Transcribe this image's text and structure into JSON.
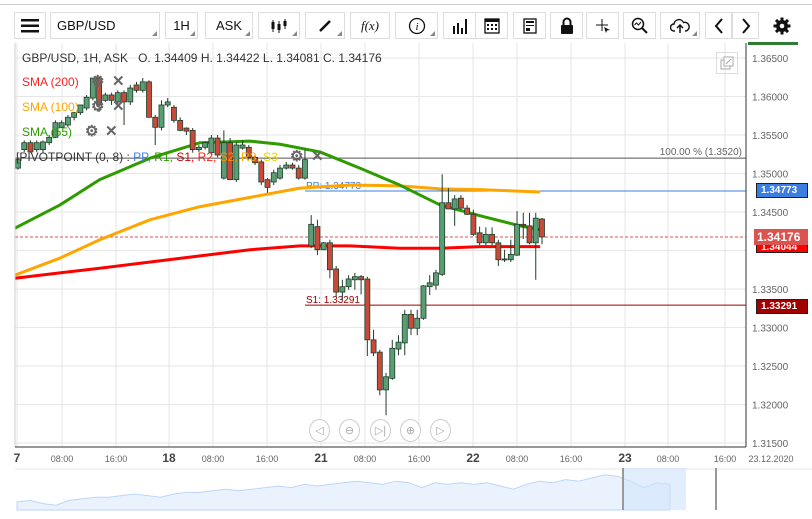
{
  "toolbar": {
    "menu_icon": "hamburger-icon",
    "symbol": "GBP/USD",
    "timeframe": "1H",
    "price_side": "ASK",
    "buttons": [
      "candle-type-icon",
      "pen-icon",
      "function-icon",
      "info-icon",
      "bar-chart-icon",
      "calendar-icon",
      "report-icon",
      "lock-icon",
      "crosshair-icon",
      "zoom-icon",
      "cloud-upload-icon",
      "chevron-left-icon",
      "chevron-right-icon",
      "gear-icon"
    ],
    "function_label": "f(x)"
  },
  "header": {
    "instrument": "GBP/USD, 1H, ASK",
    "o_label": "O.",
    "o": "1.34409",
    "h_label": "H.",
    "h": "1.34422",
    "l_label": "L.",
    "l": "1.34081",
    "c_label": "C.",
    "c": "1.34176"
  },
  "indicators": [
    {
      "label": "SMA (200)",
      "color": "#ff0000"
    },
    {
      "label": "SMA (100)",
      "color": "#ffa500"
    },
    {
      "label": "SMA (55)",
      "color": "#2e9b00"
    }
  ],
  "pivot": {
    "label": "PIVOTPOINT (0, 8)",
    "sep": " : ",
    "items": [
      {
        "t": "PP,",
        "c": "#3b82f6"
      },
      {
        "t": "R1,",
        "c": "#2e9b00"
      },
      {
        "t": "S1,",
        "c": "#cc0000"
      },
      {
        "t": "R2,",
        "c": "#ff2020"
      },
      {
        "t": "S2,",
        "c": "#ff8c00"
      },
      {
        "t": "R3,",
        "c": "#ffa500"
      },
      {
        "t": "S3",
        "c": "#e8d800"
      }
    ]
  },
  "chart_data": {
    "type": "candlestick",
    "ylim": [
      1.315,
      1.3665
    ],
    "y_ticks": [
      "1.36500",
      "1.36000",
      "1.35500",
      "1.35000",
      "1.34500",
      "1.33500",
      "1.33000",
      "1.32500",
      "1.32000",
      "1.31500"
    ],
    "x_ticks": [
      "7",
      "08:00",
      "16:00",
      "18",
      "08:00",
      "16:00",
      "21",
      "08:00",
      "16:00",
      "22",
      "08:00",
      "16:00",
      "23",
      "08:00",
      "16:00"
    ],
    "x_end_label": "23.12.2020",
    "up_color": "#5a9e74",
    "down_color": "#c94a38",
    "candles": [
      [
        1.3507,
        1.3521,
        1.3505,
        1.3518
      ],
      [
        1.3531,
        1.3543,
        1.3528,
        1.354
      ],
      [
        1.354,
        1.3543,
        1.3527,
        1.3528
      ],
      [
        1.3531,
        1.3543,
        1.3528,
        1.354
      ],
      [
        1.3531,
        1.3543,
        1.3527,
        1.3541
      ],
      [
        1.354,
        1.355,
        1.3537,
        1.3547
      ],
      [
        1.3547,
        1.3569,
        1.3546,
        1.3566
      ],
      [
        1.356,
        1.3569,
        1.3559,
        1.3566
      ],
      [
        1.3563,
        1.3576,
        1.356,
        1.3573
      ],
      [
        1.3573,
        1.358,
        1.3569,
        1.3579
      ],
      [
        1.3579,
        1.3589,
        1.3576,
        1.3589
      ],
      [
        1.3585,
        1.3602,
        1.3582,
        1.3599
      ],
      [
        1.3598,
        1.3624,
        1.3595,
        1.3624
      ],
      [
        1.3624,
        1.3624,
        1.358,
        1.3589
      ],
      [
        1.3595,
        1.3605,
        1.3593,
        1.3602
      ],
      [
        1.3602,
        1.3605,
        1.3589,
        1.3595
      ],
      [
        1.3593,
        1.3608,
        1.3589,
        1.3605
      ],
      [
        1.3605,
        1.3608,
        1.3563,
        1.3593
      ],
      [
        1.3593,
        1.3615,
        1.3589,
        1.3611
      ],
      [
        1.3615,
        1.3619,
        1.3605,
        1.3608
      ],
      [
        1.3608,
        1.3624,
        1.3605,
        1.3619
      ],
      [
        1.3619,
        1.3621,
        1.3573,
        1.3573
      ],
      [
        1.3573,
        1.3576,
        1.3537,
        1.356
      ],
      [
        1.356,
        1.3595,
        1.3556,
        1.3589
      ],
      [
        1.3589,
        1.3598,
        1.3586,
        1.3593
      ],
      [
        1.3586,
        1.3589,
        1.3566,
        1.3569
      ],
      [
        1.3569,
        1.3573,
        1.3555,
        1.3556
      ],
      [
        1.3559,
        1.356,
        1.355,
        1.3555
      ],
      [
        1.3556,
        1.3559,
        1.3527,
        1.3531
      ],
      [
        1.3531,
        1.3537,
        1.3528,
        1.3534
      ],
      [
        1.3534,
        1.3541,
        1.3531,
        1.354
      ],
      [
        1.3527,
        1.355,
        1.3524,
        1.3546
      ],
      [
        1.3546,
        1.355,
        1.3521,
        1.3524
      ],
      [
        1.3494,
        1.3556,
        1.3492,
        1.354
      ],
      [
        1.354,
        1.3546,
        1.3492,
        1.3492
      ],
      [
        1.3492,
        1.3541,
        1.3489,
        1.3537
      ],
      [
        1.3533,
        1.3543,
        1.3531,
        1.3537
      ],
      [
        1.3534,
        1.3537,
        1.3518,
        1.3521
      ],
      [
        1.3521,
        1.3524,
        1.3511,
        1.3514
      ],
      [
        1.3515,
        1.3518,
        1.3485,
        1.3489
      ],
      [
        1.3492,
        1.3494,
        1.3475,
        1.3482
      ],
      [
        1.3489,
        1.3505,
        1.3485,
        1.3501
      ],
      [
        1.3494,
        1.3511,
        1.3492,
        1.3507
      ],
      [
        1.3507,
        1.3515,
        1.3505,
        1.3511
      ],
      [
        1.3511,
        1.3514,
        1.3505,
        1.3507
      ],
      [
        1.3507,
        1.3511,
        1.3492,
        1.3494
      ],
      [
        1.3494,
        1.3531,
        1.3492,
        1.3518
      ],
      [
        1.3406,
        1.3446,
        1.3403,
        1.3434
      ],
      [
        1.3431,
        1.344,
        1.3394,
        1.3401
      ],
      [
        1.3401,
        1.3411,
        1.3401,
        1.341
      ],
      [
        1.341,
        1.3414,
        1.3364,
        1.3375
      ],
      [
        1.3376,
        1.338,
        1.334,
        1.3346
      ],
      [
        1.3346,
        1.3362,
        1.3336,
        1.3353
      ],
      [
        1.3353,
        1.3368,
        1.3349,
        1.3363
      ],
      [
        1.3362,
        1.3371,
        1.3349,
        1.3366
      ],
      [
        1.3366,
        1.3368,
        1.3343,
        1.3362
      ],
      [
        1.3363,
        1.3366,
        1.3263,
        1.3284
      ],
      [
        1.3284,
        1.3297,
        1.3263,
        1.3267
      ],
      [
        1.3268,
        1.3271,
        1.3212,
        1.3219
      ],
      [
        1.3219,
        1.3241,
        1.3186,
        1.3236
      ],
      [
        1.3234,
        1.3284,
        1.3232,
        1.3273
      ],
      [
        1.3272,
        1.329,
        1.3264,
        1.3281
      ],
      [
        1.328,
        1.3323,
        1.3264,
        1.3317
      ],
      [
        1.3317,
        1.3323,
        1.329,
        1.3299
      ],
      [
        1.3299,
        1.3323,
        1.329,
        1.3312
      ],
      [
        1.3312,
        1.3355,
        1.331,
        1.3354
      ],
      [
        1.3353,
        1.3368,
        1.3342,
        1.3358
      ],
      [
        1.3355,
        1.3375,
        1.3349,
        1.3371
      ],
      [
        1.3369,
        1.3499,
        1.3367,
        1.3462
      ],
      [
        1.3462,
        1.3481,
        1.3454,
        1.3454
      ],
      [
        1.3454,
        1.3472,
        1.3432,
        1.3467
      ],
      [
        1.3468,
        1.3472,
        1.3453,
        1.3455
      ],
      [
        1.3455,
        1.3459,
        1.3446,
        1.3447
      ],
      [
        1.3447,
        1.3453,
        1.3419,
        1.3421
      ],
      [
        1.3423,
        1.3431,
        1.3407,
        1.341
      ],
      [
        1.341,
        1.343,
        1.3407,
        1.3421
      ],
      [
        1.3421,
        1.343,
        1.3407,
        1.341
      ],
      [
        1.341,
        1.3414,
        1.338,
        1.3388
      ],
      [
        1.3389,
        1.3401,
        1.3385,
        1.3389
      ],
      [
        1.3388,
        1.3414,
        1.3385,
        1.3395
      ],
      [
        1.3394,
        1.3451,
        1.3393,
        1.3434
      ],
      [
        1.3434,
        1.3449,
        1.3415,
        1.3432
      ],
      [
        1.3432,
        1.3449,
        1.3408,
        1.341
      ],
      [
        1.341,
        1.3449,
        1.3362,
        1.3442
      ],
      [
        1.34409,
        1.34422,
        1.34081,
        1.34176
      ]
    ],
    "sma": [
      {
        "name": "SMA (55)",
        "color": "#2e9b00",
        "points": [
          [
            -0.5,
            1.3429
          ],
          [
            6.7,
            1.3459
          ],
          [
            13.1,
            1.3492
          ],
          [
            21.2,
            1.352
          ],
          [
            29.2,
            1.354
          ],
          [
            37.2,
            1.3542
          ],
          [
            42,
            1.3538
          ],
          [
            48.4,
            1.3528
          ],
          [
            54.8,
            1.3507
          ],
          [
            61.2,
            1.3485
          ],
          [
            67.7,
            1.3459
          ],
          [
            74.1,
            1.3445
          ],
          [
            80.5,
            1.3432
          ],
          [
            83.7,
            1.3427
          ]
        ]
      },
      {
        "name": "SMA (100)",
        "color": "#ffa500",
        "points": [
          [
            -0.5,
            1.3368
          ],
          [
            6.7,
            1.339
          ],
          [
            13.1,
            1.3414
          ],
          [
            21.2,
            1.344
          ],
          [
            29.2,
            1.3457
          ],
          [
            37.2,
            1.3469
          ],
          [
            45.2,
            1.3481
          ],
          [
            53.2,
            1.3485
          ],
          [
            61.2,
            1.3484
          ],
          [
            67.7,
            1.348
          ],
          [
            74.1,
            1.3479
          ],
          [
            83.7,
            1.3476
          ]
        ]
      },
      {
        "name": "SMA (200)",
        "color": "#ff0000",
        "points": [
          [
            -0.5,
            1.3364
          ],
          [
            6.7,
            1.3371
          ],
          [
            13.1,
            1.3377
          ],
          [
            21.2,
            1.3385
          ],
          [
            29.2,
            1.3393
          ],
          [
            37.2,
            1.3401
          ],
          [
            45.2,
            1.3406
          ],
          [
            53.2,
            1.3406
          ],
          [
            61.2,
            1.3403
          ],
          [
            67.7,
            1.3403
          ],
          [
            74.1,
            1.3405
          ],
          [
            83.7,
            1.3405
          ]
        ]
      }
    ],
    "lines": {
      "fib": {
        "label": "100.00 % (1.3520)",
        "value": 1.352,
        "color": "#555555"
      },
      "pp": {
        "label": "PP: 1.34773",
        "value": 1.34773,
        "tag": "1.34773",
        "color": "#3b7de0"
      },
      "s1": {
        "label": "S1: 1.33291",
        "value": 1.33291,
        "tag": "1.33291",
        "color": "#a00000"
      },
      "current": {
        "value": 1.34176,
        "tag": "1.34176",
        "color": "#d9534f"
      },
      "sma200_tag": {
        "value": 1.34044,
        "tag": "1.34044",
        "color": "#ff0000"
      }
    }
  },
  "navigator": {
    "values": [
      5,
      6,
      4,
      3,
      6,
      7,
      8,
      8,
      9,
      10,
      9,
      8,
      10,
      11,
      11,
      12,
      13,
      12,
      13,
      14,
      15,
      14,
      16,
      15,
      16,
      17,
      18,
      17,
      16,
      18,
      17,
      14,
      17,
      16,
      17,
      16,
      17,
      15,
      13,
      16,
      18,
      17,
      19,
      18,
      20,
      22,
      21,
      18,
      14,
      17,
      16
    ]
  },
  "nav_buttons": [
    "scroll-left-icon",
    "zoom-out-icon",
    "go-to-end-icon",
    "zoom-in-icon",
    "scroll-right-icon"
  ],
  "popout_icon": "popout-icon"
}
